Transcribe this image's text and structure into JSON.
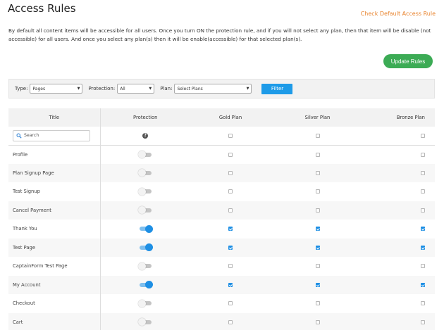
{
  "header": {
    "title": "Access Rules",
    "default_link": "Check Default Access Rule",
    "description": "By default all content items will be accessible for all users. Once you turn ON the protection rule, and if you will not select any plan, then that item will be disable (not accessible) for all users. And once you select any plan(s) then it will be enable(accessible) for that selected plan(s).",
    "update_button": "Update Rules"
  },
  "filter": {
    "type_label": "Type:",
    "type_value": "Pages",
    "protection_label": "Protection:",
    "protection_value": "All",
    "plan_label": "Plan:",
    "plan_value": "Select Plans",
    "filter_button": "Filter"
  },
  "table": {
    "columns": [
      "Title",
      "Protection",
      "Gold Plan",
      "Silver Plan",
      "Bronze Plan"
    ],
    "search_placeholder": "Search",
    "rows": [
      {
        "title": "Profile",
        "protected": false,
        "gold": false,
        "silver": false,
        "bronze": false
      },
      {
        "title": "Plan Signup Page",
        "protected": false,
        "gold": false,
        "silver": false,
        "bronze": false
      },
      {
        "title": "Test Signup",
        "protected": false,
        "gold": false,
        "silver": false,
        "bronze": false
      },
      {
        "title": "Cancel Payment",
        "protected": false,
        "gold": false,
        "silver": false,
        "bronze": false
      },
      {
        "title": "Thank You",
        "protected": true,
        "gold": true,
        "silver": true,
        "bronze": true
      },
      {
        "title": "Test Page",
        "protected": true,
        "gold": true,
        "silver": true,
        "bronze": true
      },
      {
        "title": "CaptainForm Test Page",
        "protected": false,
        "gold": false,
        "silver": false,
        "bronze": false
      },
      {
        "title": "My Account",
        "protected": true,
        "gold": true,
        "silver": true,
        "bronze": true
      },
      {
        "title": "Checkout",
        "protected": false,
        "gold": false,
        "silver": false,
        "bronze": false
      },
      {
        "title": "Cart",
        "protected": false,
        "gold": false,
        "silver": false,
        "bronze": false
      }
    ]
  },
  "colors": {
    "accent_orange": "#e8822b",
    "update_green": "#3cab55",
    "filter_blue": "#1e9be8",
    "toggle_on": "#1e8fe4"
  },
  "icons": {
    "search": "search-icon",
    "help": "help-icon",
    "dropdown": "chevron-down-icon"
  }
}
